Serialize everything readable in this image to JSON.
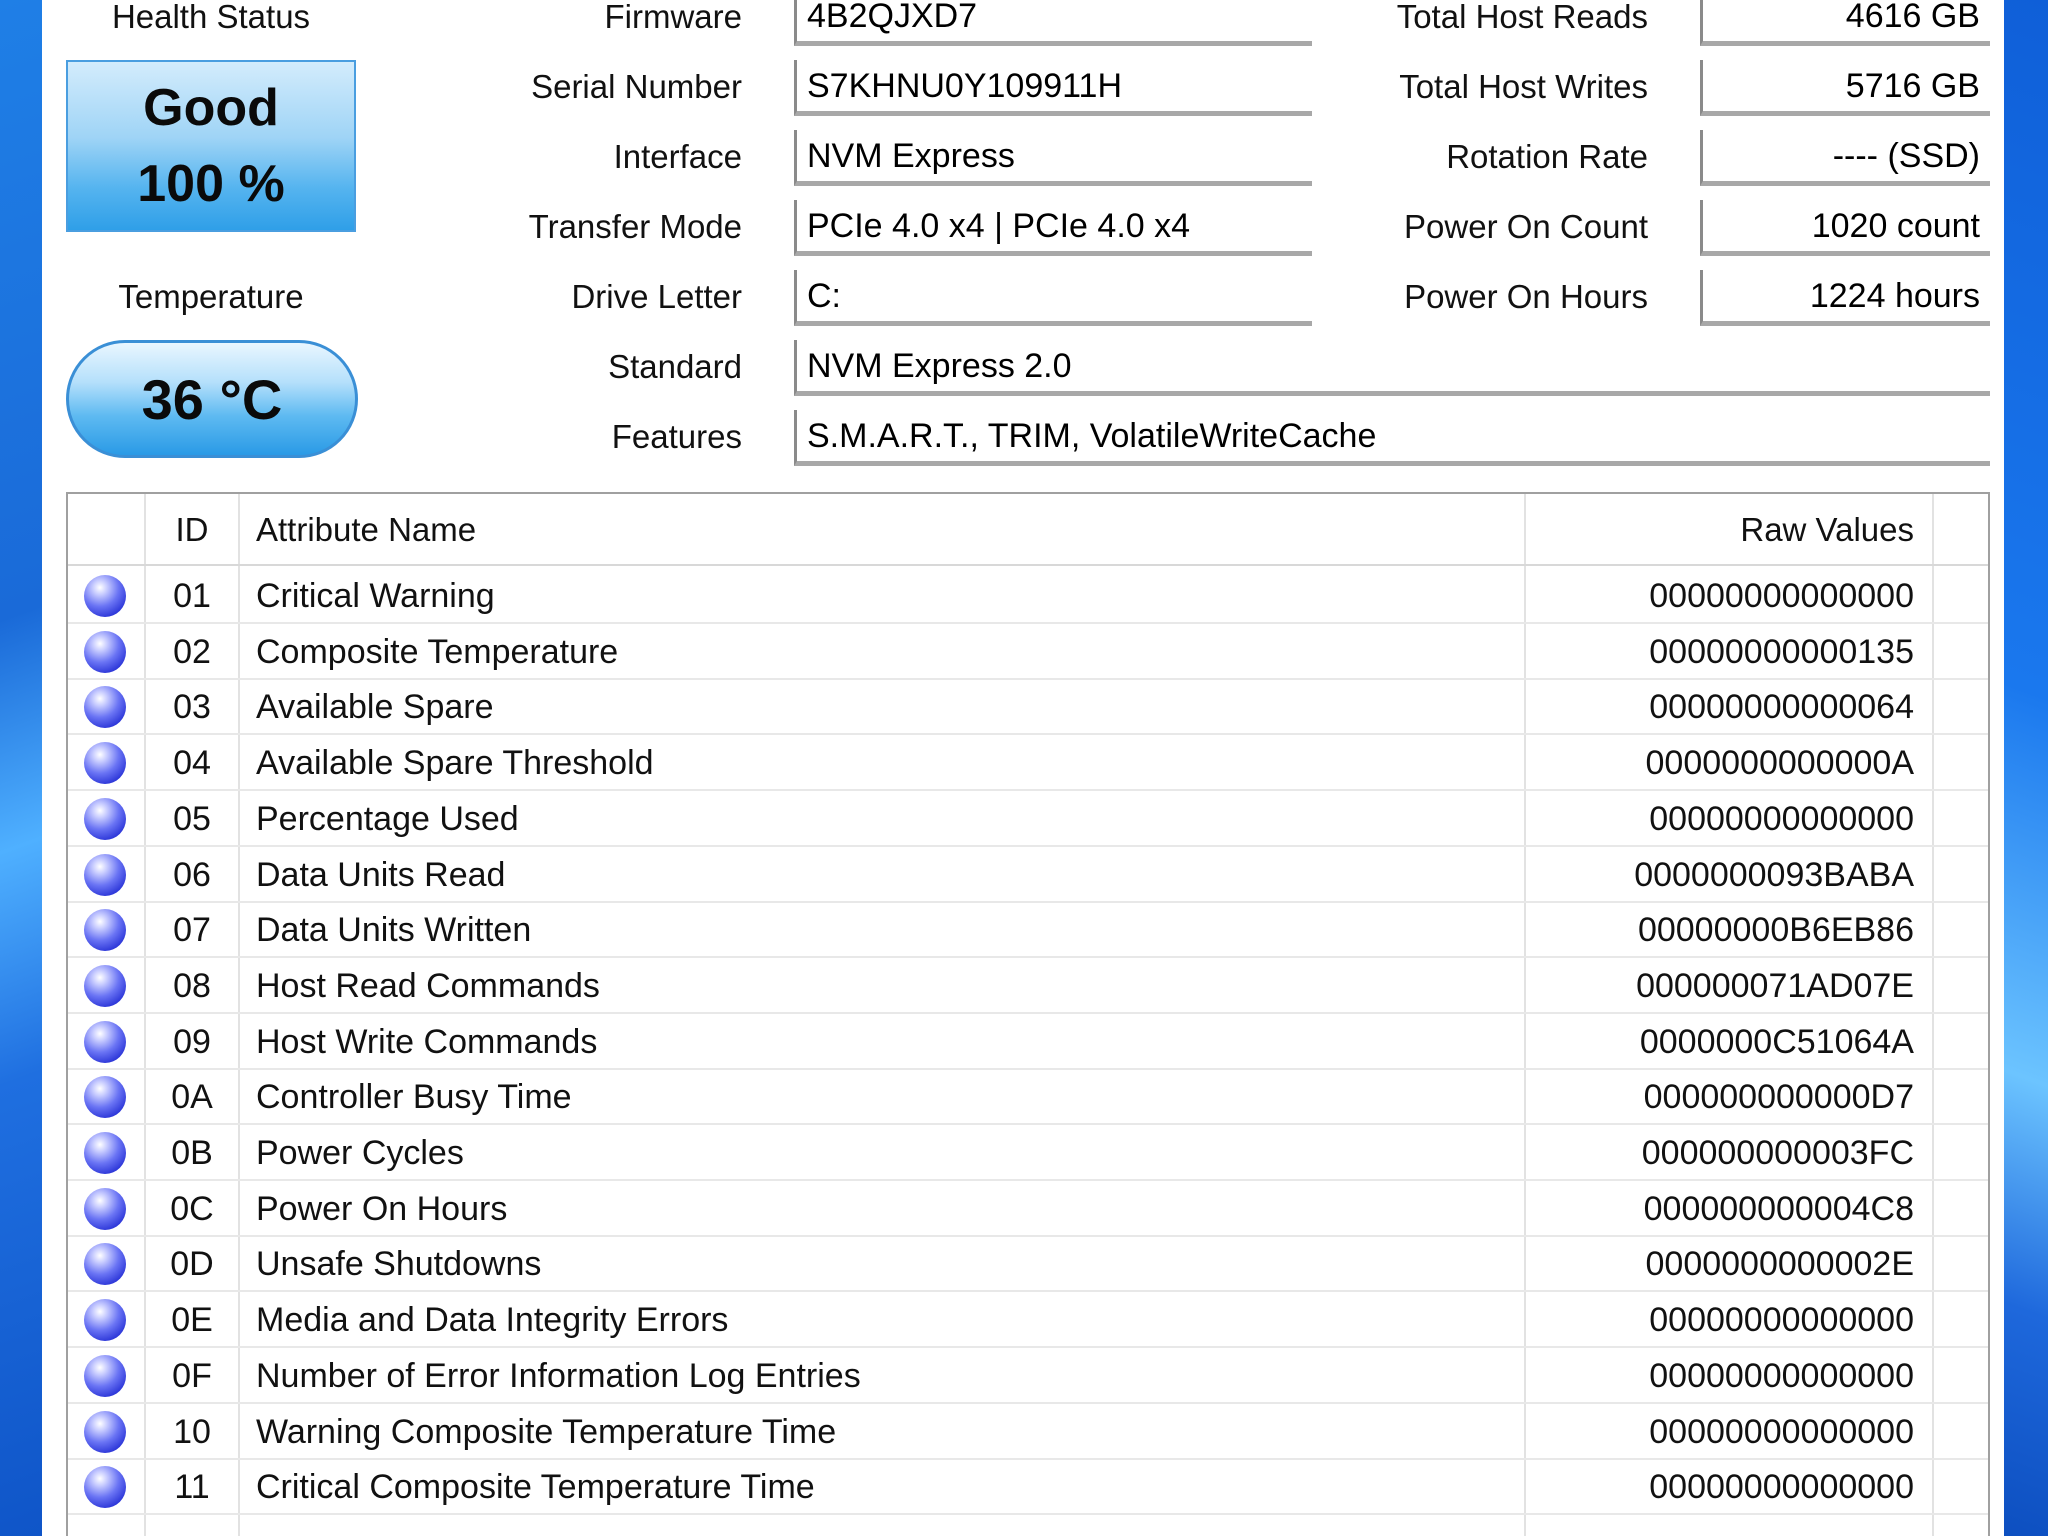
{
  "status": {
    "health_label": "Health Status",
    "health_text": "Good",
    "health_percent": "100 %",
    "temperature_label": "Temperature",
    "temperature_value": "36 °C"
  },
  "info": {
    "firmware_label": "Firmware",
    "firmware": "4B2QJXD7",
    "serial_label": "Serial Number",
    "serial": "S7KHNU0Y109911H",
    "interface_label": "Interface",
    "interface": "NVM Express",
    "transfer_label": "Transfer Mode",
    "transfer": "PCIe 4.0 x4 | PCIe 4.0 x4",
    "drive_letter_label": "Drive Letter",
    "drive_letter": "C:",
    "standard_label": "Standard",
    "standard": "NVM Express 2.0",
    "features_label": "Features",
    "features": "S.M.A.R.T., TRIM, VolatileWriteCache",
    "host_reads_label": "Total Host Reads",
    "host_reads": "4616 GB",
    "host_writes_label": "Total Host Writes",
    "host_writes": "5716 GB",
    "rotation_label": "Rotation Rate",
    "rotation": "---- (SSD)",
    "power_count_label": "Power On Count",
    "power_count": "1020 count",
    "power_hours_label": "Power On Hours",
    "power_hours": "1224 hours"
  },
  "table": {
    "columns": {
      "id": "ID",
      "name": "Attribute Name",
      "raw": "Raw Values"
    },
    "rows": [
      {
        "id": "01",
        "name": "Critical Warning",
        "raw": "00000000000000"
      },
      {
        "id": "02",
        "name": "Composite Temperature",
        "raw": "00000000000135"
      },
      {
        "id": "03",
        "name": "Available Spare",
        "raw": "00000000000064"
      },
      {
        "id": "04",
        "name": "Available Spare Threshold",
        "raw": "0000000000000A"
      },
      {
        "id": "05",
        "name": "Percentage Used",
        "raw": "00000000000000"
      },
      {
        "id": "06",
        "name": "Data Units Read",
        "raw": "0000000093BABA"
      },
      {
        "id": "07",
        "name": "Data Units Written",
        "raw": "00000000B6EB86"
      },
      {
        "id": "08",
        "name": "Host Read Commands",
        "raw": "000000071AD07E"
      },
      {
        "id": "09",
        "name": "Host Write Commands",
        "raw": "0000000C51064A"
      },
      {
        "id": "0A",
        "name": "Controller Busy Time",
        "raw": "000000000000D7"
      },
      {
        "id": "0B",
        "name": "Power Cycles",
        "raw": "000000000003FC"
      },
      {
        "id": "0C",
        "name": "Power On Hours",
        "raw": "000000000004C8"
      },
      {
        "id": "0D",
        "name": "Unsafe Shutdowns",
        "raw": "0000000000002E"
      },
      {
        "id": "0E",
        "name": "Media and Data Integrity Errors",
        "raw": "00000000000000"
      },
      {
        "id": "0F",
        "name": "Number of Error Information Log Entries",
        "raw": "00000000000000"
      },
      {
        "id": "10",
        "name": "Warning Composite Temperature Time",
        "raw": "00000000000000"
      },
      {
        "id": "11",
        "name": "Critical Composite Temperature Time",
        "raw": "00000000000000"
      }
    ]
  },
  "colors": {
    "status_good": "#2f9fe8",
    "status_dot": "#2c36d8"
  },
  "icons": {
    "row_status": "status-dot-icon"
  }
}
